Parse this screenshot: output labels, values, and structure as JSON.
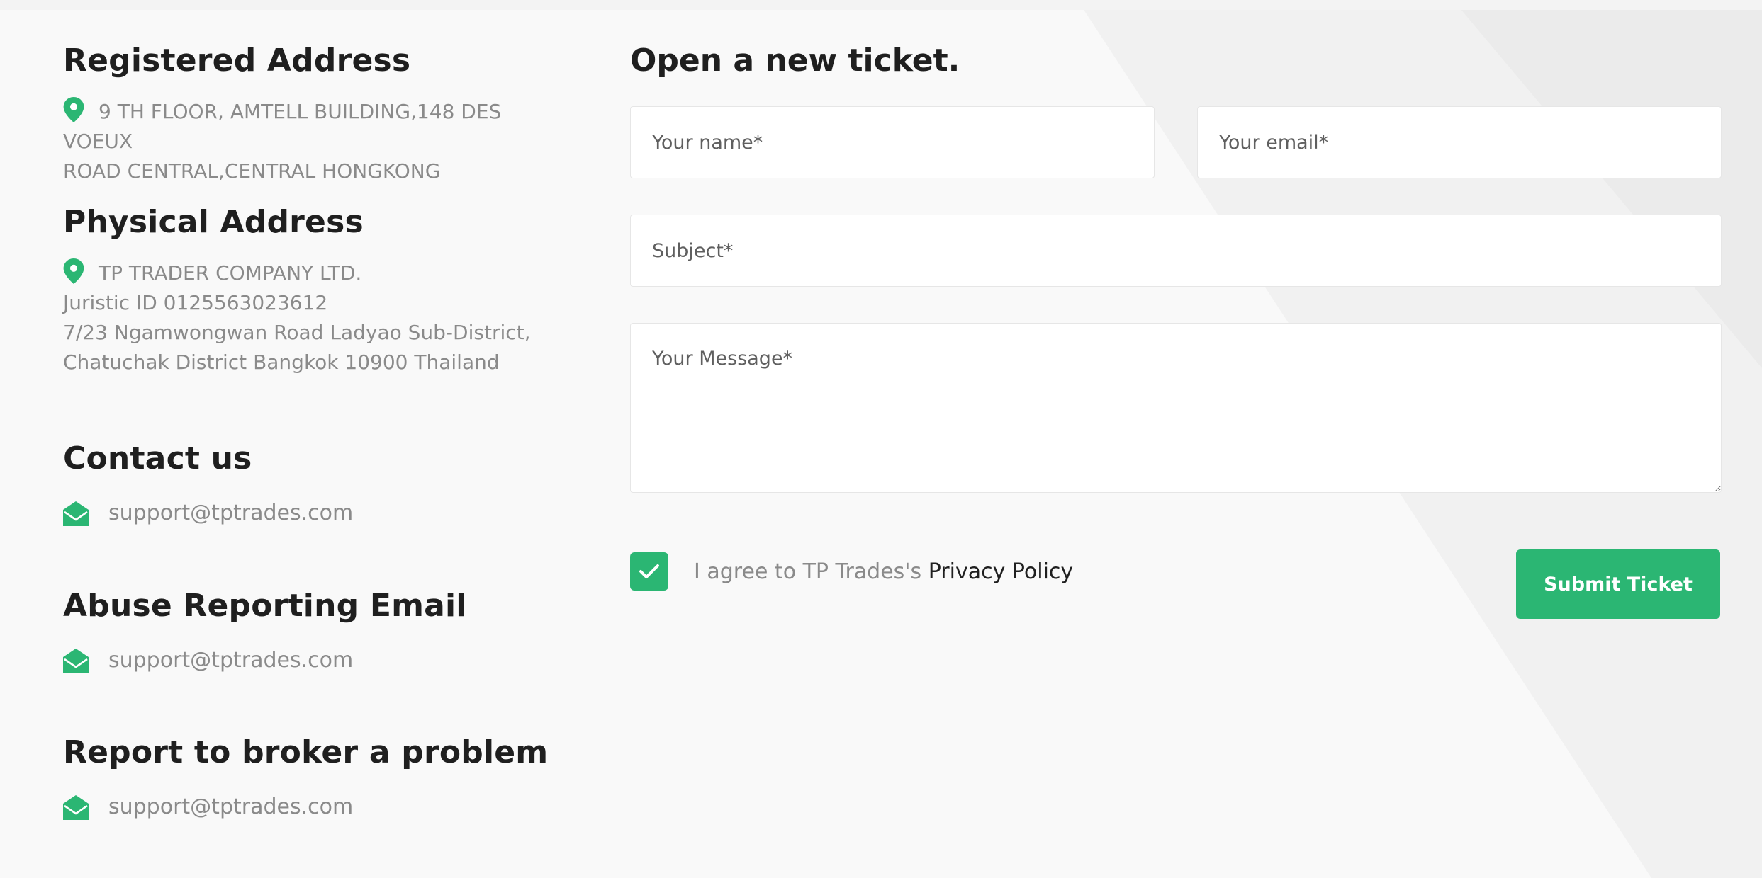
{
  "registered": {
    "title": "Registered Address",
    "line1": "9 TH FLOOR, AMTELL BUILDING,148 DES VOEUX",
    "line2": "ROAD CENTRAL,CENTRAL HONGKONG"
  },
  "physical": {
    "title": "Physical Address",
    "line1": "TP TRADER COMPANY LTD.",
    "line2": "Juristic ID 0125563023612",
    "line3": "7/23 Ngamwongwan Road Ladyao Sub-District,",
    "line4": "Chatuchak District Bangkok 10900 Thailand"
  },
  "contact": {
    "title": "Contact us",
    "email": "support@tptrades.com"
  },
  "abuse": {
    "title": "Abuse Reporting Email",
    "email": "support@tptrades.com"
  },
  "report": {
    "title": "Report to broker a problem",
    "email": "support@tptrades.com"
  },
  "form": {
    "title": "Open a new ticket.",
    "name_placeholder": "Your name*",
    "email_placeholder": "Your email*",
    "subject_placeholder": "Subject*",
    "message_placeholder": "Your Message*",
    "agree_prefix": "I agree to TP Trades's",
    "privacy_link": "Privacy Policy",
    "submit_label": "Submit Ticket",
    "agree_checked": true
  },
  "colors": {
    "accent": "#2bb673",
    "muted_text": "#8a8a8a",
    "heading": "#1f1f1f"
  }
}
